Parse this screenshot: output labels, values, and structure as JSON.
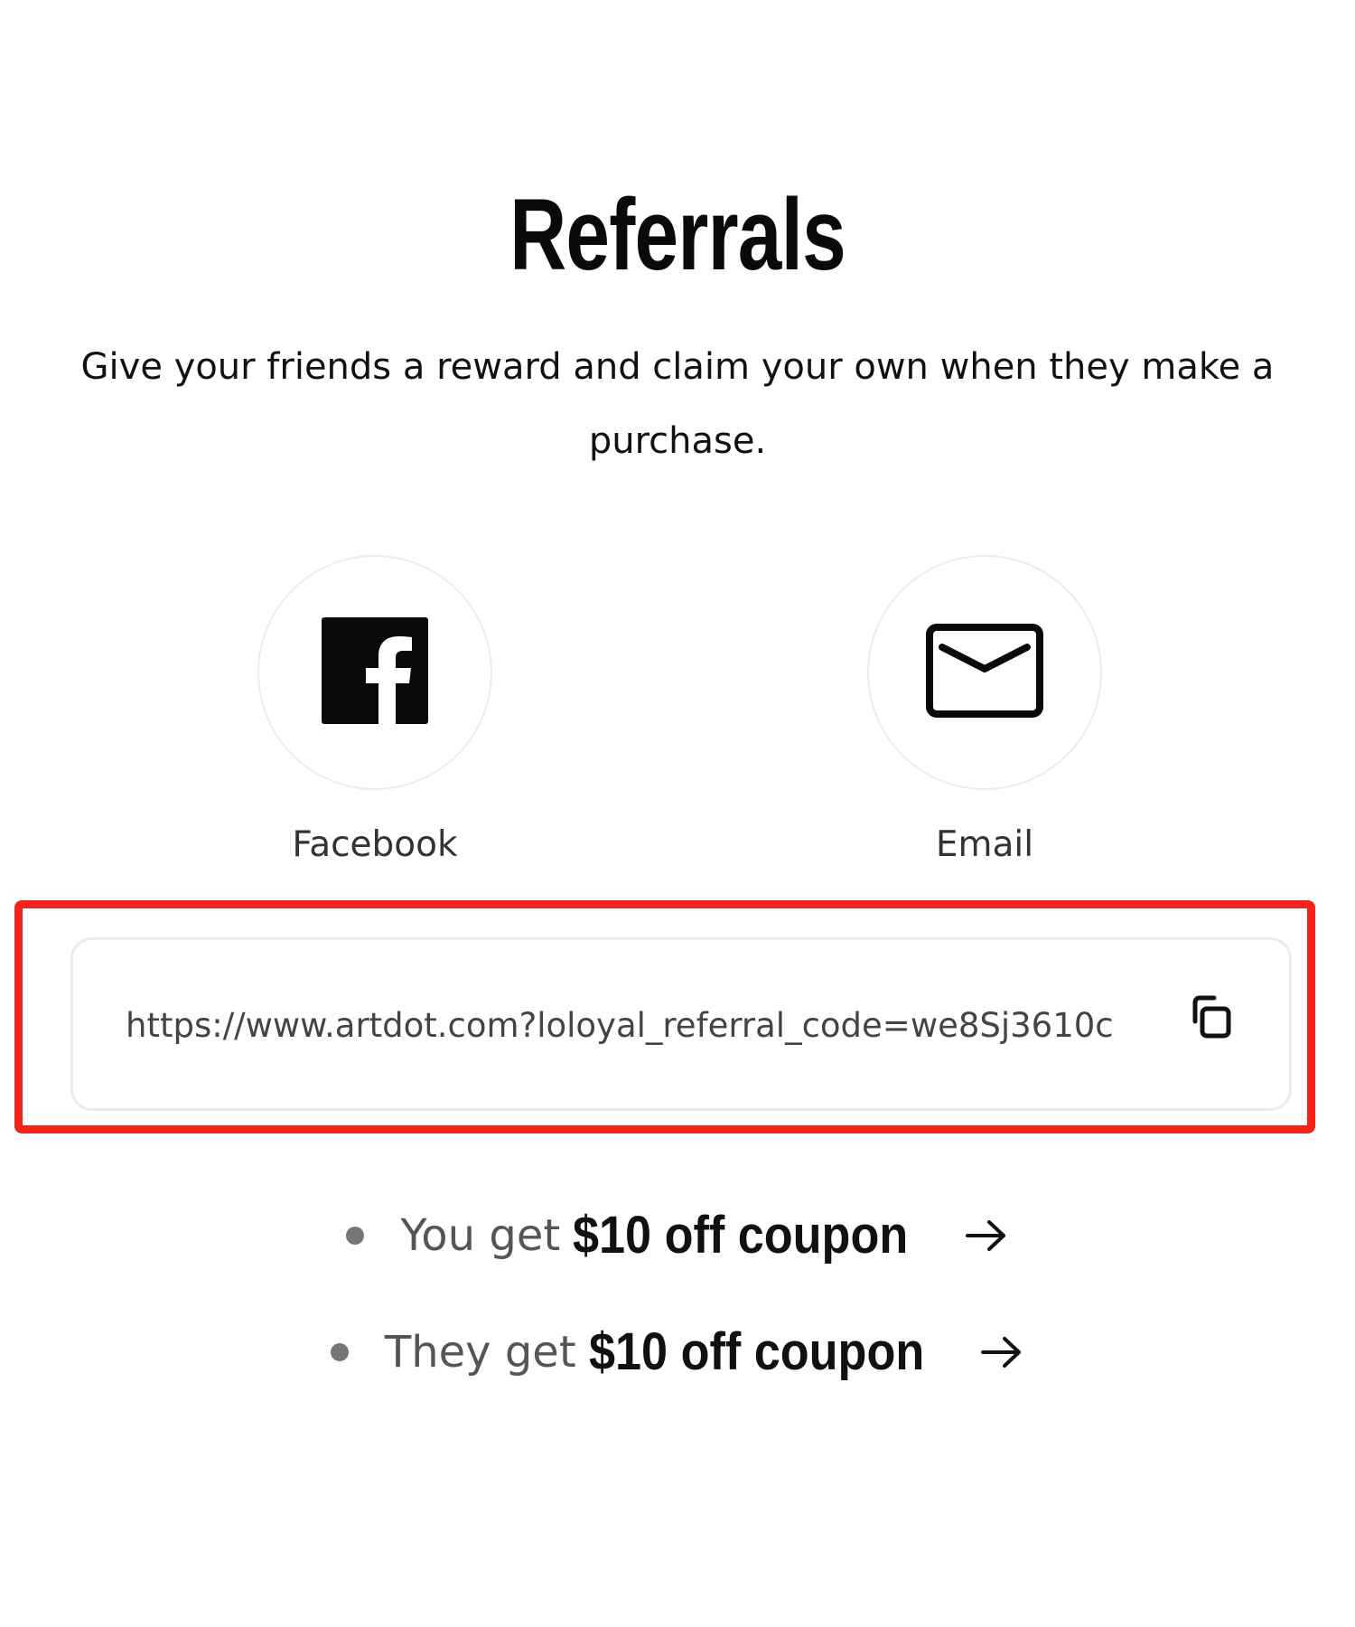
{
  "header": {
    "title": "Referrals",
    "description": "Give your friends a reward and claim your own when they make a purchase."
  },
  "share": {
    "options": [
      {
        "label": "Facebook",
        "icon": "facebook-icon"
      },
      {
        "label": "Email",
        "icon": "envelope-icon"
      }
    ]
  },
  "referral_link": {
    "value": "https://www.artdot.com?loloyal_referral_code=we8Sj3610c",
    "copy_icon": "copy-icon",
    "highlight_color": "#f2231a"
  },
  "rewards": [
    {
      "prefix": "You get",
      "amount": "$10 off coupon"
    },
    {
      "prefix": "They get",
      "amount": "$10 off coupon"
    }
  ]
}
